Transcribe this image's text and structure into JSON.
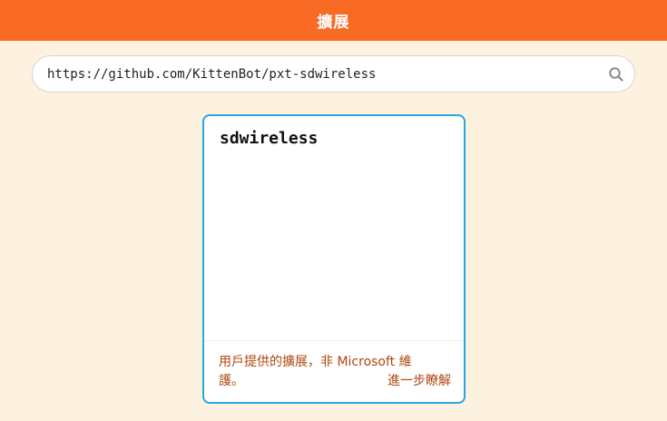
{
  "header": {
    "title": "擴展"
  },
  "search": {
    "value": "https://github.com/KittenBot/pxt-sdwireless",
    "icon": "search-icon"
  },
  "results": [
    {
      "title": "sdwireless",
      "note": "用戶提供的擴展，非 Microsoft 維護。",
      "link_label": "進一步瞭解"
    }
  ],
  "colors": {
    "header_bg": "#f96b24",
    "page_bg": "#fdf1e0",
    "card_border": "#2aa7e0",
    "note_text": "#b0450e"
  }
}
